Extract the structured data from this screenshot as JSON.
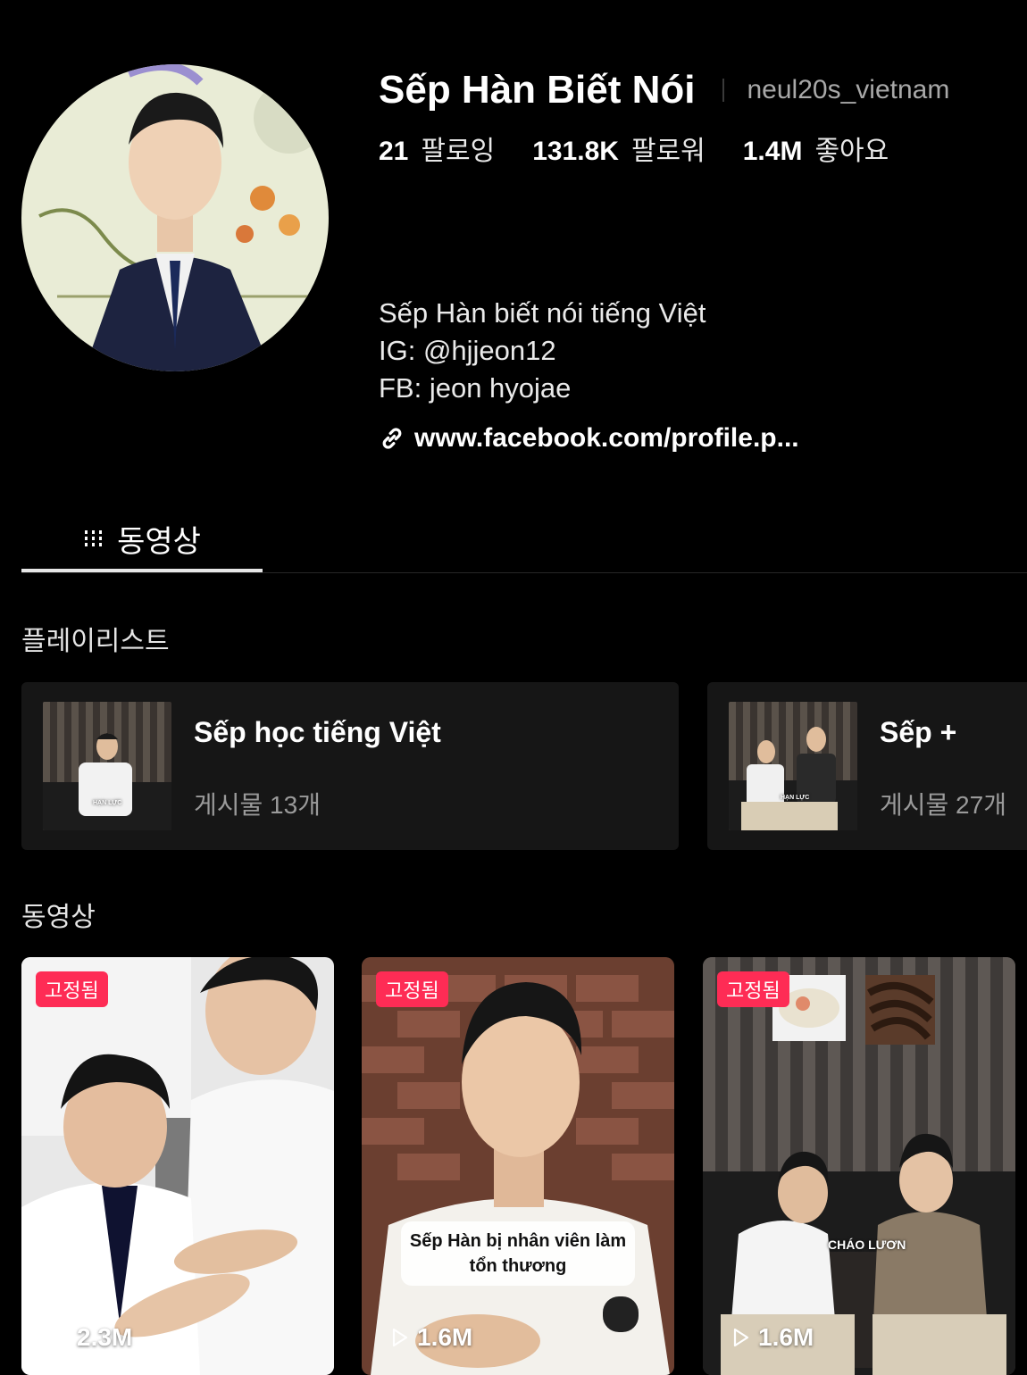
{
  "profile": {
    "display_name": "Sếp Hàn Biết Nói",
    "handle": "neul20s_vietnam",
    "stats": [
      {
        "value": "21",
        "label": "팔로잉"
      },
      {
        "value": "131.8K",
        "label": "팔로워"
      },
      {
        "value": "1.4M",
        "label": "좋아요"
      }
    ],
    "bio_lines": [
      "Sếp Hàn biết nói tiếng Việt",
      "IG: @hjjeon12",
      "FB: jeon hyojae"
    ],
    "link": "www.facebook.com/profile.p..."
  },
  "tabs": [
    {
      "label": "동영상",
      "icon": "grid-icon",
      "active": true
    }
  ],
  "playlists_section": {
    "title": "플레이리스트",
    "items": [
      {
        "title": "Sếp học tiếng Việt",
        "count": "게시물 13개",
        "thumb_caption": "HẠN LỰC"
      },
      {
        "title": "Sếp +",
        "count": "게시물 27개",
        "thumb_caption": "HẠN LỰC"
      }
    ]
  },
  "videos_section": {
    "title": "동영상",
    "items": [
      {
        "pinned_label": "고정됨",
        "views": "2.3M"
      },
      {
        "pinned_label": "고정됨",
        "views": "1.6M",
        "caption": "Sếp Hàn bị nhân viên làm tổn thương"
      },
      {
        "pinned_label": "고정됨",
        "views": "1.6M",
        "overlay_text": "CHÁO LƯƠN"
      }
    ]
  },
  "colors": {
    "background": "#000000",
    "card": "#161616",
    "pinned_badge": "#fe2c55",
    "muted_text": "#a8a8a8"
  }
}
